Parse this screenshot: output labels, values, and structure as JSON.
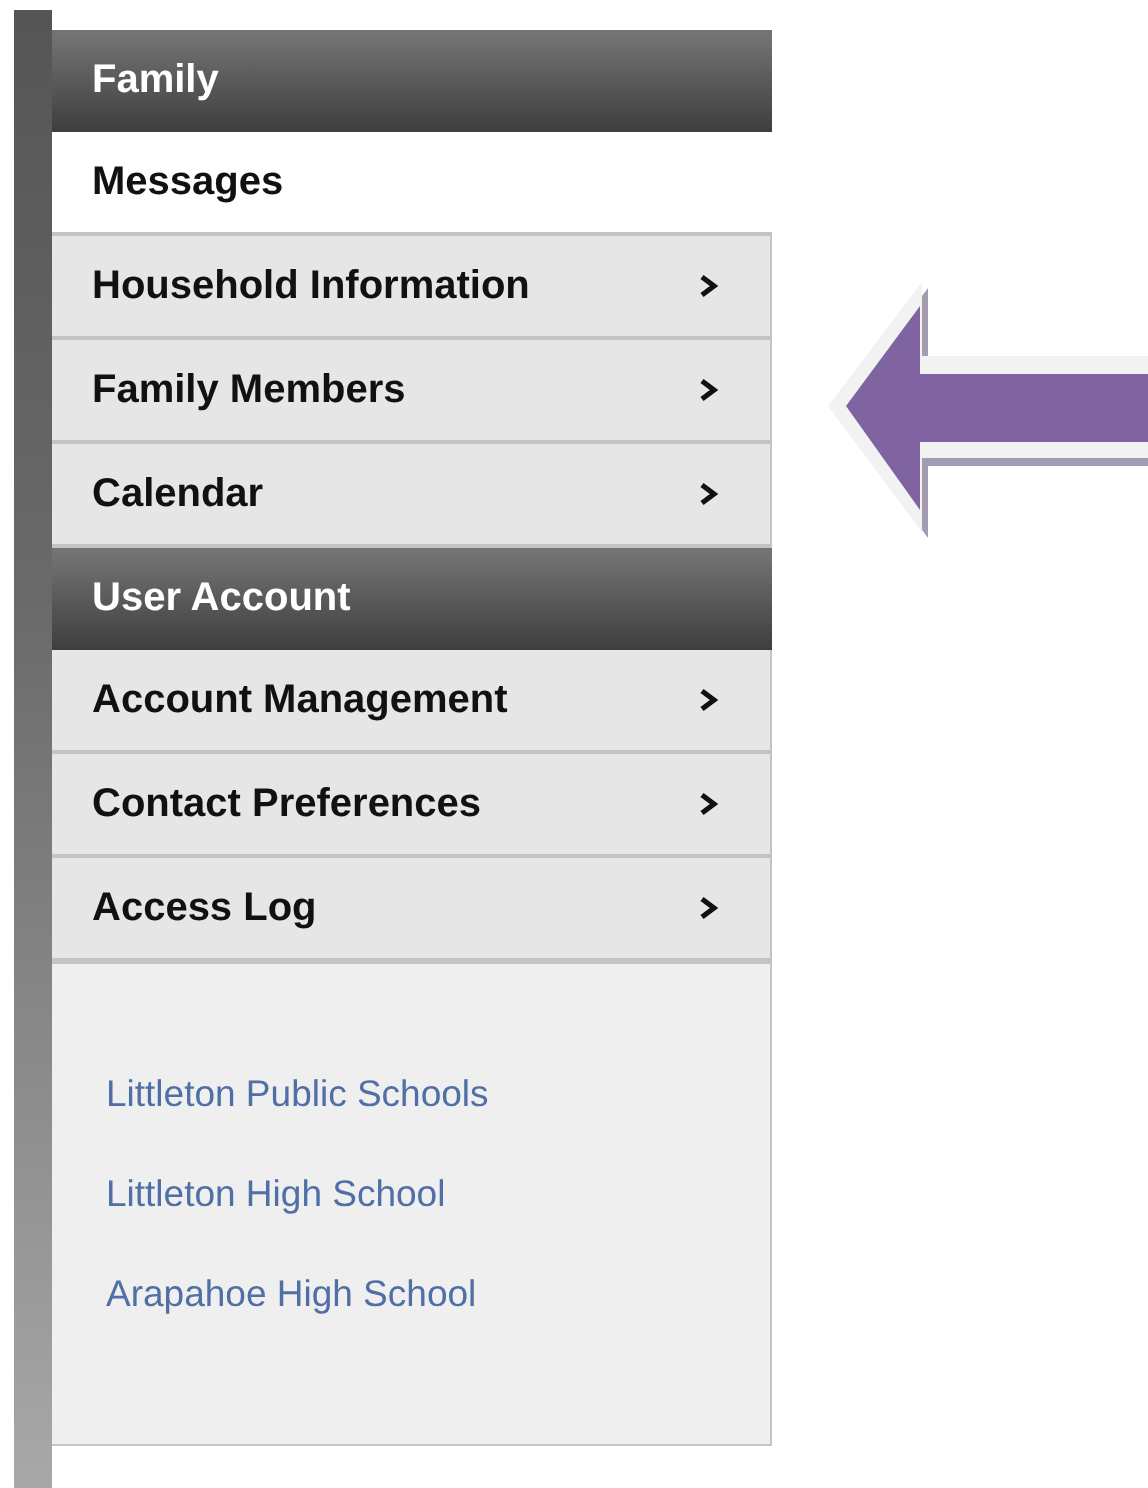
{
  "sections": [
    {
      "title": "Family",
      "items": [
        {
          "label": "Messages",
          "selected": true,
          "submenu": false
        },
        {
          "label": "Household Information",
          "selected": false,
          "submenu": true
        },
        {
          "label": "Family Members",
          "selected": false,
          "submenu": true
        },
        {
          "label": "Calendar",
          "selected": false,
          "submenu": true
        }
      ]
    },
    {
      "title": "User Account",
      "items": [
        {
          "label": "Account Management",
          "selected": false,
          "submenu": true
        },
        {
          "label": "Contact Preferences",
          "selected": false,
          "submenu": true
        },
        {
          "label": "Access Log",
          "selected": false,
          "submenu": true
        }
      ]
    }
  ],
  "links": [
    "Littleton Public Schools",
    "Littleton High School",
    "Arapahoe High School"
  ]
}
